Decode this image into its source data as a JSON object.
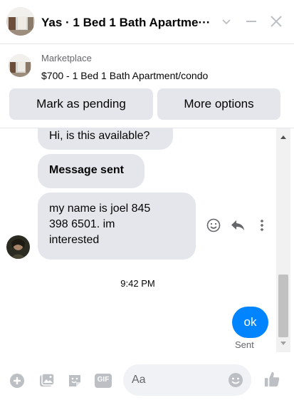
{
  "header": {
    "title": "Yas · 1 Bed 1 Bath Apartme···",
    "icons": [
      "chevron-down-icon",
      "minimize-icon",
      "close-icon"
    ]
  },
  "marketplace": {
    "label": "Marketplace",
    "listing": "$700 - 1 Bed 1 Bath Apartment/condo",
    "buttons": {
      "pending": "Mark as pending",
      "more": "More options"
    }
  },
  "messages": [
    {
      "from": "them",
      "text": "Hi, is this available?"
    },
    {
      "from": "them",
      "text": "Message sent",
      "bold": true
    },
    {
      "from": "them",
      "lines": [
        "my name is joel 845",
        "398 6501. im",
        "interested"
      ]
    }
  ],
  "timestamp": "9:42 PM",
  "my_message": {
    "text": "ok",
    "status": "Sent"
  },
  "composer": {
    "placeholder": "Aa",
    "icons": [
      "add-icon",
      "photo-icon",
      "sticker-icon",
      "gif-icon",
      "emoji-icon",
      "thumbs-up-icon"
    ],
    "gif_label": "GIF"
  },
  "colors": {
    "accent": "#0084ff",
    "bubble_gray": "#e4e6eb",
    "icon_gray": "#65676b"
  }
}
